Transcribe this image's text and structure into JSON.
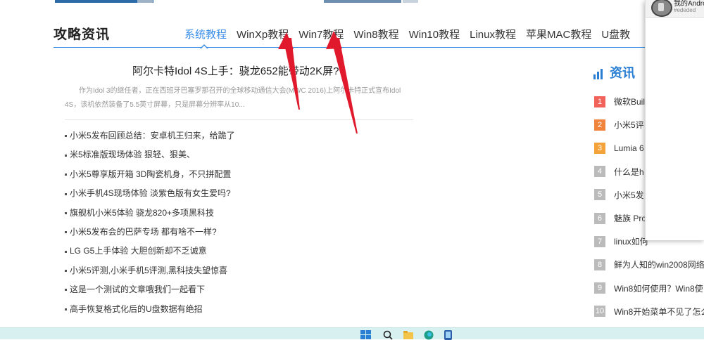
{
  "section": {
    "title": "攻略资讯",
    "tabs": [
      {
        "label": "系统教程",
        "active": true
      },
      {
        "label": "WinXp教程"
      },
      {
        "label": "Win7教程"
      },
      {
        "label": "Win8教程"
      },
      {
        "label": "Win10教程"
      },
      {
        "label": "Linux教程"
      },
      {
        "label": "苹果MAC教程"
      },
      {
        "label": "U盘教"
      }
    ]
  },
  "feature": {
    "title": "阿尔卡特Idol 4S上手：骁龙652能带动2K屏?",
    "desc": "作为Idol 3的继任者，正在西班牙巴塞罗那召开的全球移动通信大会(MWC 2016)上阿尔卡特正式宣布Idol 4S，该机依然装备了5.5英寸屏幕，只是屏幕分辨率从10..."
  },
  "articles": [
    "小米5发布回顾总结：安卓机王归来，给跪了",
    "米5标准版现场体验 狠轻、狠美、",
    "小米5尊享版开箱 3D陶瓷机身，不只拼配置",
    "小米手机4S现场体验 淡紫色版有女生爱吗?",
    "旗舰机小米5体验 骁龙820+多项黑科技",
    "小米5发布会的巴萨专场 都有啥不一样?",
    "LG G5上手体验 大胆创新却不乏诚意",
    "小米5评测,小米手机5评测,黑科技失望惊喜",
    "这是一个测试的文章哦我们一起看下",
    "高手恢复格式化后的U盘数据有绝招"
  ],
  "sidebar": {
    "title": "资讯",
    "ranks": [
      {
        "num": "1",
        "text": "微软Buil",
        "color": "#f0625a"
      },
      {
        "num": "2",
        "text": "小米5评",
        "color": "#f0843c"
      },
      {
        "num": "3",
        "text": "Lumia 6",
        "color": "#f4a23a"
      },
      {
        "num": "4",
        "text": "什么是h",
        "color": "#bbbbbb"
      },
      {
        "num": "5",
        "text": "小米5发",
        "color": "#bbbbbb"
      },
      {
        "num": "6",
        "text": "魅族 Pro",
        "color": "#bbbbbb"
      },
      {
        "num": "7",
        "text": "linux如何",
        "color": "#bbbbbb"
      },
      {
        "num": "8",
        "text": "鲜为人知的win2008网络",
        "color": "#bbbbbb"
      },
      {
        "num": "9",
        "text": "Win8如何使用？Win8使",
        "color": "#bbbbbb"
      },
      {
        "num": "10",
        "text": "Win8开始菜单不见了怎么",
        "color": "#bbbbbb"
      }
    ]
  },
  "popup": {
    "name": "我的Andro",
    "sub": "#ededed"
  },
  "colors": {
    "accent": "#3b8ee8",
    "arrow": "#e0192d",
    "taskbar": "#d8f0f0"
  },
  "taskbar_icons": [
    "windows-start-icon",
    "search-icon",
    "file-explorer-icon",
    "edge-browser-icon",
    "phone-link-icon"
  ]
}
